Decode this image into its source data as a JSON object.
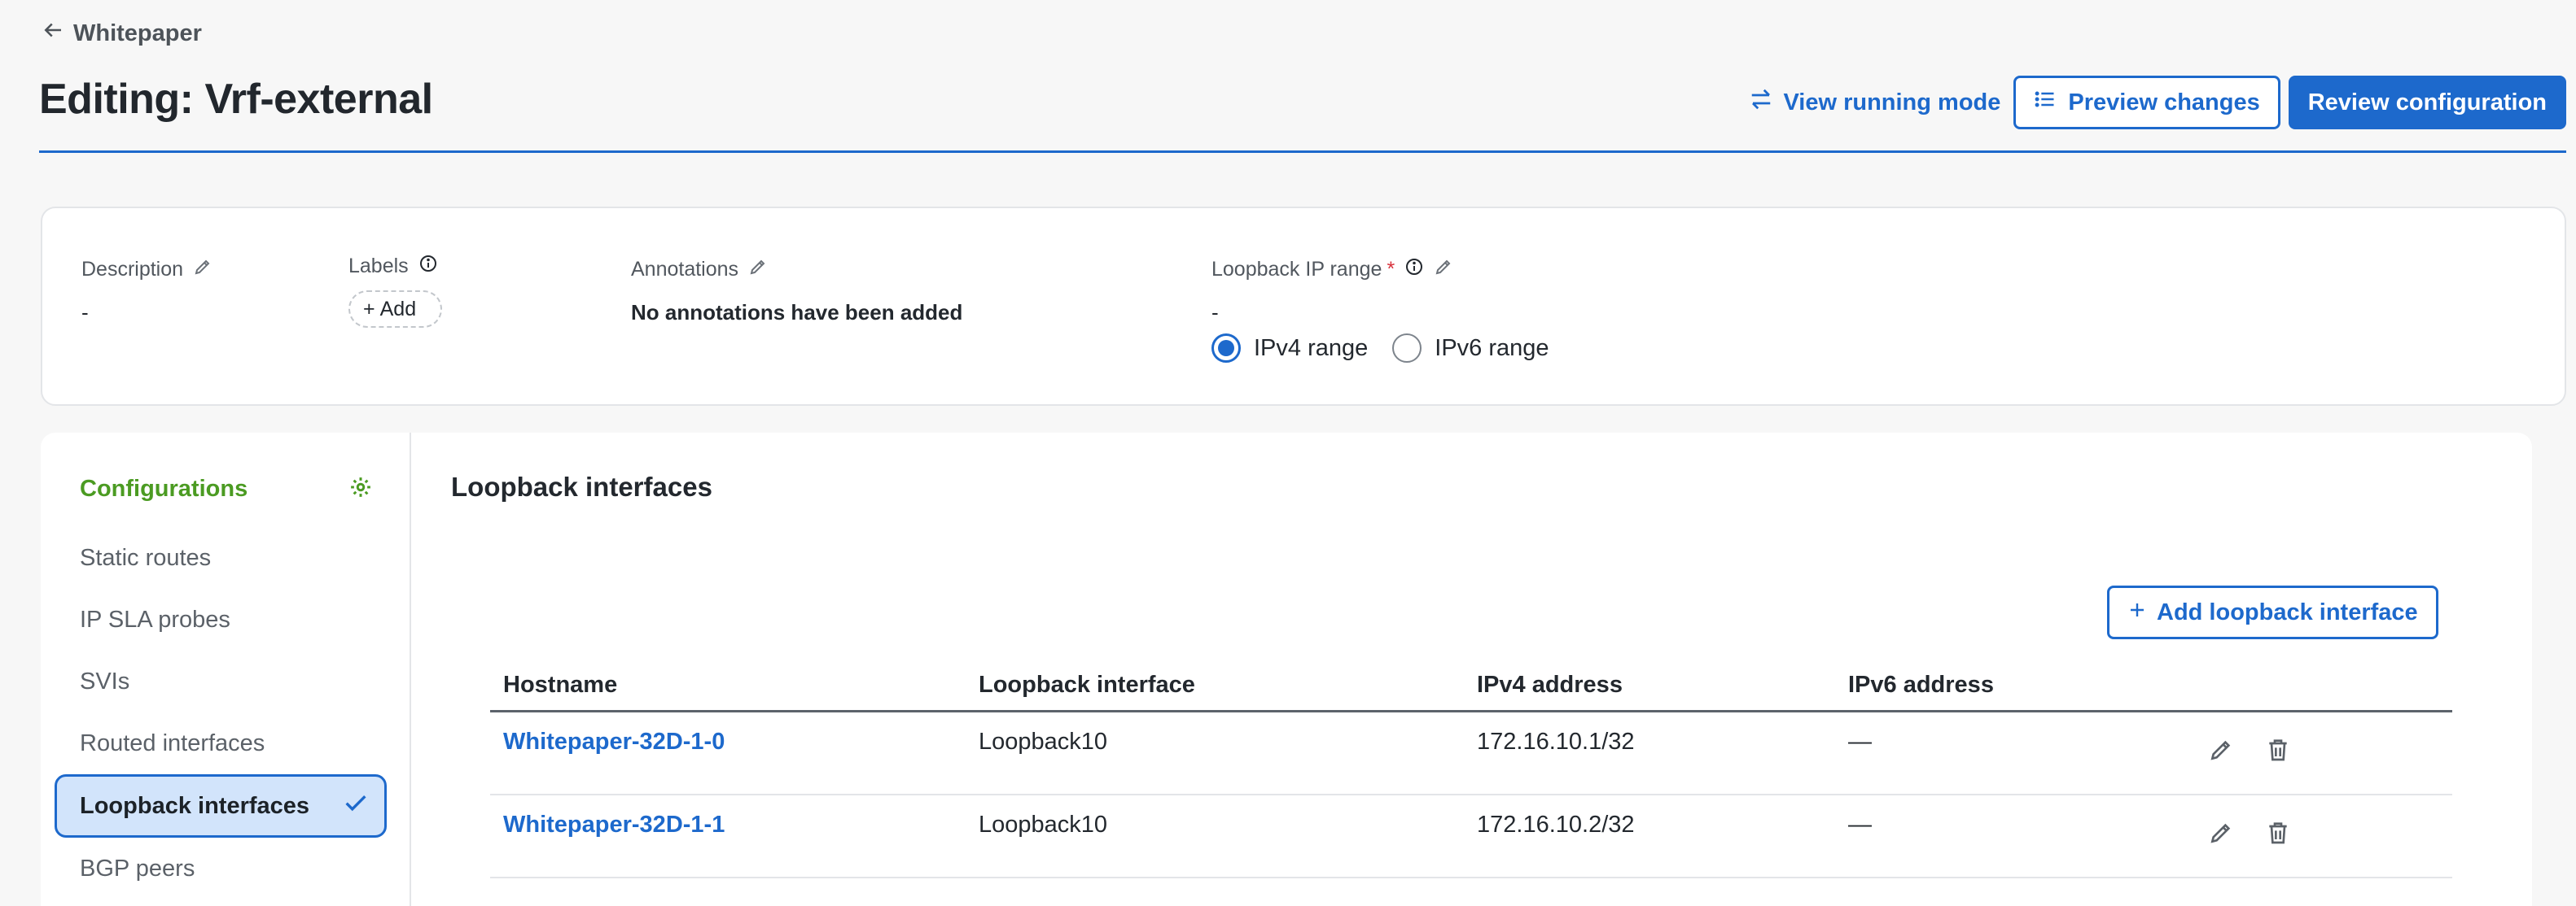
{
  "header": {
    "back_label": "Whitepaper",
    "title": "Editing: Vrf-external",
    "view_running_mode": "View running mode",
    "preview_changes": "Preview changes",
    "review_configuration": "Review configuration"
  },
  "info": {
    "description": {
      "label": "Description",
      "value": "-"
    },
    "labels": {
      "label": "Labels",
      "add": "Add"
    },
    "annotations": {
      "label": "Annotations",
      "value": "No annotations have been added"
    },
    "loopback": {
      "label": "Loopback IP range",
      "required": "*",
      "value": "-",
      "options": [
        "IPv4 range",
        "IPv6 range"
      ],
      "selected": "IPv4 range"
    }
  },
  "sidebar": {
    "title": "Configurations",
    "items": [
      {
        "label": "Static routes"
      },
      {
        "label": "IP SLA probes"
      },
      {
        "label": "SVIs"
      },
      {
        "label": "Routed interfaces"
      },
      {
        "label": "Loopback interfaces",
        "active": true
      },
      {
        "label": "BGP peers"
      }
    ]
  },
  "main": {
    "title": "Loopback interfaces",
    "add_button": "Add loopback interface",
    "columns": [
      "Hostname",
      "Loopback interface",
      "IPv4 address",
      "IPv6 address"
    ],
    "rows": [
      {
        "hostname": "Whitepaper-32D-1-0",
        "loopback": "Loopback10",
        "ipv4": "172.16.10.1/32",
        "ipv6": "—"
      },
      {
        "hostname": "Whitepaper-32D-1-1",
        "loopback": "Loopback10",
        "ipv4": "172.16.10.2/32",
        "ipv6": "—"
      }
    ]
  },
  "colors": {
    "accent": "#1d69cc",
    "success": "#4b9b22",
    "active_bg": "#d2e4fb"
  }
}
